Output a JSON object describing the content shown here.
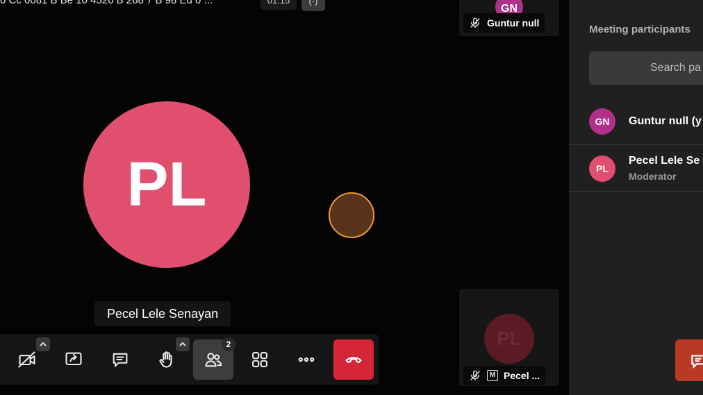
{
  "topbar": {
    "meeting_title": "0 Cc 0081 B Be 10 4526 B 268 7 B 98 Ed 0 ...",
    "timer": "01:15",
    "indicator_label": "(·)"
  },
  "stage": {
    "active_speaker": {
      "initials": "PL",
      "name": "Pecel Lele Senayan",
      "avatar_color": "#e0506e"
    }
  },
  "filmstrip": {
    "thumbnails": [
      {
        "initials": "GN",
        "name": "Guntur null",
        "muted": true,
        "avatar_color": "#b0308c"
      },
      {
        "initials": "PL",
        "name": "Pecel ...",
        "muted": true,
        "moderator_badge": "M",
        "avatar_color": "#5b1b25"
      }
    ]
  },
  "toolbar": {
    "buttons": [
      {
        "name": "camera",
        "icon": "video-off-icon"
      },
      {
        "name": "share",
        "icon": "screen-share-icon"
      },
      {
        "name": "chat",
        "icon": "chat-icon"
      },
      {
        "name": "raise-hand",
        "icon": "hand-icon"
      },
      {
        "name": "participants",
        "icon": "participants-icon",
        "badge": "2"
      },
      {
        "name": "tile-view",
        "icon": "grid-icon"
      },
      {
        "name": "more",
        "icon": "more-icon"
      },
      {
        "name": "hangup",
        "icon": "hangup-icon"
      }
    ],
    "participants_count": "2",
    "hangup_color": "#d42637"
  },
  "side_panel": {
    "title": "Meeting participants",
    "search_placeholder": "Search pa",
    "participants": [
      {
        "initials": "GN",
        "name": "Guntur null (y",
        "role": "",
        "avatar_color": "#b0308c"
      },
      {
        "initials": "PL",
        "name": "Pecel Lele Se",
        "role": "Moderator",
        "avatar_color": "#e0506e"
      }
    ],
    "chat_button_color": "#b83a26"
  }
}
